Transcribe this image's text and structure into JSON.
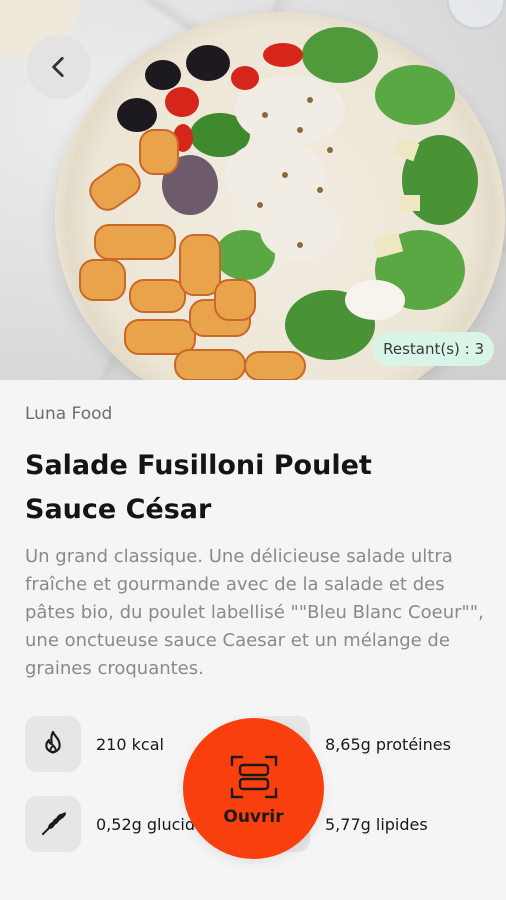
{
  "header": {
    "back_icon": "chevron-left-icon"
  },
  "product": {
    "remaining": "Restant(s) : 3",
    "brand": "Luna Food",
    "title": "Salade Fusilloni Poulet Sauce César",
    "description": "Un grand classique. Une délicieuse salade ultra fraîche et gourmande avec de la salade et des pâtes bio, du poulet labellisé \"\"Bleu Blanc Coeur\"\", une onctueuse sauce Caesar et un mélange de graines croquantes."
  },
  "nutrition": {
    "kcal": {
      "icon": "flame-icon",
      "label": "210 kcal"
    },
    "proteins": {
      "icon": "protein-icon",
      "label": "8,65g protéines"
    },
    "carbs": {
      "icon": "wheat-icon",
      "label": "0,52g glucides"
    },
    "lipids": {
      "icon": "drop-icon",
      "label": "5,77g lipides"
    }
  },
  "action": {
    "label": "Ouvrir",
    "icon": "scan-icon",
    "color": "#fa3f0f"
  },
  "colors": {
    "remaining_badge": "#d9f5e8",
    "background": "#f5f5f5"
  }
}
